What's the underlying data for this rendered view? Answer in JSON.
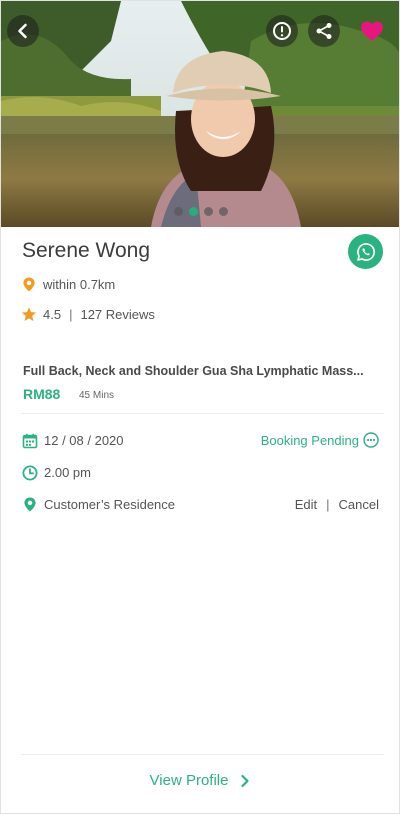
{
  "profile": {
    "name": "Serene Wong",
    "distance": "within 0.7km",
    "rating": "4.5",
    "reviews": "127 Reviews"
  },
  "gallery": {
    "total_photos": 4,
    "active_index": 1
  },
  "service": {
    "title": "Full Back, Neck and Shoulder Gua Sha Lymphatic Mass...",
    "price": "RM88",
    "duration": "45 Mins"
  },
  "booking": {
    "date": "12 / 08 / 2020",
    "time": "2.00 pm",
    "location": "Customer’s Residence",
    "status": "Booking Pending",
    "edit_label": "Edit",
    "separator": "|",
    "cancel_label": "Cancel"
  },
  "footer": {
    "view_profile_label": "View Profile"
  },
  "icons": {
    "back": "chevron-left-icon",
    "report": "exclamation-icon",
    "share": "share-icon",
    "favorite": "heart-icon",
    "whatsapp": "whatsapp-icon",
    "distance": "map-pin-icon",
    "rating": "star-icon",
    "date": "calendar-icon",
    "time": "clock-icon",
    "location": "location-pin-icon",
    "status": "more-dots-icon",
    "view_profile": "chevron-right-icon"
  },
  "colors": {
    "accent": "#2bb281",
    "favorite": "#e8157e",
    "pin_orange": "#f39a1f"
  }
}
